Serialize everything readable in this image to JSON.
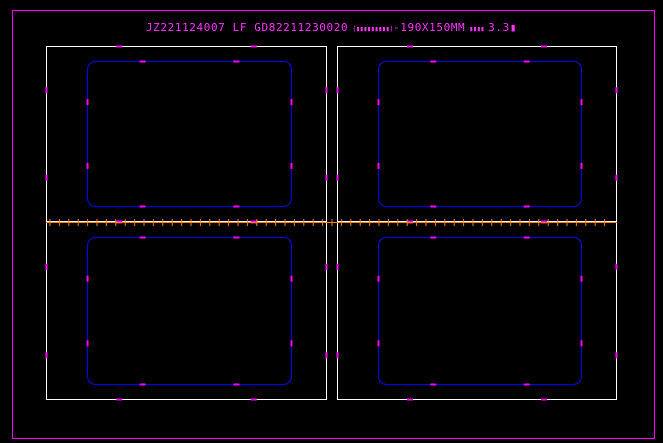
{
  "drawing": {
    "title": {
      "code": "JZ221124007 LF GD82211230020",
      "paren_glyphs": "(▮▮▮▮▮▮▮▮▮)",
      "size": "-190X150MM",
      "mid_glyphs": "▮▮▮▮",
      "suffix": "3.3▮"
    },
    "panels": [
      {
        "id": "panel-top-left"
      },
      {
        "id": "panel-top-right"
      },
      {
        "id": "panel-bottom-left"
      },
      {
        "id": "panel-bottom-right"
      }
    ]
  },
  "colors": {
    "background": "#000000",
    "outer_border": "#ff00ff",
    "panel_border": "#ffffff",
    "cut_line": "#0000ff",
    "marker": "#ff00ff",
    "center_line": "#ff8000",
    "title": "#ff33ff"
  }
}
